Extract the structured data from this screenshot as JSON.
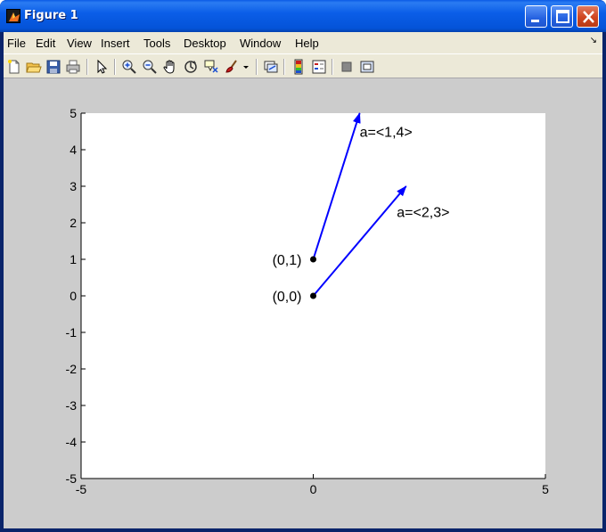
{
  "window": {
    "title": "Figure 1"
  },
  "menu": {
    "items": [
      "File",
      "Edit",
      "View",
      "Insert",
      "Tools",
      "Desktop",
      "Window",
      "Help"
    ]
  },
  "toolbar": {
    "tools": [
      "new-file",
      "open-file",
      "save",
      "print",
      "edit-plot-pointer",
      "zoom-in",
      "zoom-out",
      "pan",
      "rotate-3d",
      "data-cursor",
      "brush",
      "brush-dropdown",
      "link-plot",
      "colorbar",
      "legend",
      "hide-plot-tools",
      "show-plot-tools"
    ]
  },
  "chart_data": {
    "type": "line",
    "title": "",
    "xlabel": "",
    "ylabel": "",
    "xlim": [
      -5,
      5
    ],
    "ylim": [
      -5,
      5
    ],
    "xticks": [
      -5,
      0,
      5
    ],
    "yticks": [
      5,
      4,
      3,
      2,
      1,
      0,
      -1,
      -2,
      -3,
      -4,
      -5
    ],
    "grid": false,
    "series": [
      {
        "x": [
          0,
          1
        ],
        "y": [
          1,
          5
        ],
        "color": "#0000ff"
      },
      {
        "x": [
          0,
          2
        ],
        "y": [
          0,
          3
        ],
        "color": "#0000ff"
      }
    ],
    "points": [
      {
        "x": 0,
        "y": 1
      },
      {
        "x": 0,
        "y": 0
      }
    ],
    "annotations": [
      {
        "text": "a=<1,4>",
        "x": 1,
        "y": 4.5
      },
      {
        "text": "a=<2,3>",
        "x": 1.8,
        "y": 2.3
      },
      {
        "text": "(0,1)",
        "x": -0.25,
        "y": 1
      },
      {
        "text": "(0,0)",
        "x": -0.25,
        "y": 0
      }
    ]
  }
}
